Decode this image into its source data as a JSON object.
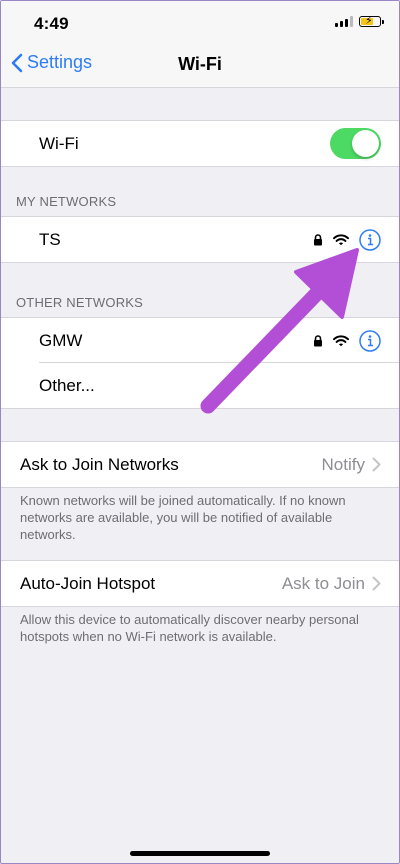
{
  "status_bar": {
    "time": "4:49"
  },
  "nav": {
    "back_label": "Settings",
    "title": "Wi-Fi"
  },
  "wifi_toggle": {
    "label": "Wi-Fi",
    "on": true
  },
  "my_networks": {
    "header": "MY NETWORKS",
    "items": [
      {
        "name": "TS",
        "secured": true
      }
    ]
  },
  "other_networks": {
    "header": "OTHER NETWORKS",
    "items": [
      {
        "name": "GMW",
        "secured": true
      }
    ],
    "other_label": "Other..."
  },
  "ask_to_join": {
    "label": "Ask to Join Networks",
    "value": "Notify",
    "footer": "Known networks will be joined automatically. If no known networks are available, you will be notified of available networks."
  },
  "auto_join": {
    "label": "Auto-Join Hotspot",
    "value": "Ask to Join",
    "footer": "Allow this device to automatically discover nearby personal hotspots when no Wi-Fi network is available."
  },
  "colors": {
    "accent": "#2f7cf6",
    "toggle_on": "#4cd964",
    "annotation_arrow": "#b24fd6"
  },
  "icons": [
    "back-chevron-icon",
    "lock-icon",
    "wifi-signal-icon",
    "info-icon",
    "chevron-right-icon",
    "cellular-signal-icon",
    "battery-icon"
  ]
}
